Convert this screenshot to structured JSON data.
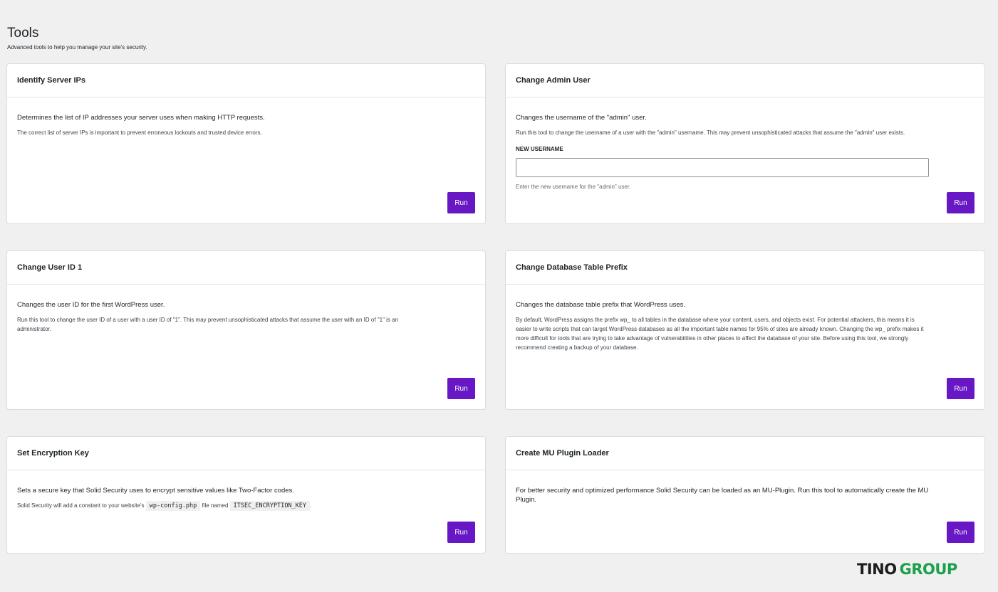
{
  "page": {
    "title": "Tools",
    "subtitle": "Advanced tools to help you manage your site's security."
  },
  "cards": {
    "identify_server_ips": {
      "title": "Identify Server IPs",
      "lead": "Determines the list of IP addresses your server uses when making HTTP requests.",
      "desc": "The correct list of server IPs is important to prevent erroneous lockouts and trusted device errors.",
      "button": "Run"
    },
    "change_admin_user": {
      "title": "Change Admin User",
      "lead": "Changes the username of the \"admin\" user.",
      "desc": "Run this tool to change the username of a user with the \"admin\" username. This may prevent unsophisticated attacks that assume the \"admin\" user exists.",
      "field_label": "NEW USERNAME",
      "field_value": "",
      "field_help": "Enter the new username for the \"admin\" user.",
      "button": "Run"
    },
    "change_user_id": {
      "title": "Change User ID 1",
      "lead": "Changes the user ID for the first WordPress user.",
      "desc": "Run this tool to change the user ID of a user with a user ID of \"1\". This may prevent unsophisticated attacks that assume the user with an ID of \"1\" is an administrator.",
      "button": "Run"
    },
    "change_db_prefix": {
      "title": "Change Database Table Prefix",
      "lead": "Changes the database table prefix that WordPress uses.",
      "desc": "By default, WordPress assigns the prefix wp_ to all tables in the database where your content, users, and objects exist. For potential attackers, this means it is easier to write scripts that can target WordPress databases as all the important table names for 95% of sites are already known. Changing the wp_ prefix makes it more difficult for tools that are trying to take advantage of vulnerabilities in other places to affect the database of your site. Before using this tool, we strongly recommend creating a backup of your database.",
      "button": "Run"
    },
    "encryption_key": {
      "title": "Set Encryption Key",
      "lead": "Sets a secure key that Solid Security uses to encrypt sensitive values like Two-Factor codes.",
      "desc_part1": "Solid Security will add a constant to your website's",
      "code1": "wp-config.php",
      "desc_part2": "file named",
      "code2": "ITSEC_ENCRYPTION_KEY",
      "desc_part3": ".",
      "button": "Run"
    },
    "mu_plugin_loader": {
      "title": "Create MU Plugin Loader",
      "lead": "For better security and optimized performance Solid Security can be loaded as an MU-Plugin. Run this tool to automatically create the MU Plugin.",
      "button": "Run"
    }
  },
  "watermark": {
    "part1": "TINO",
    "part2": "GROUP"
  }
}
